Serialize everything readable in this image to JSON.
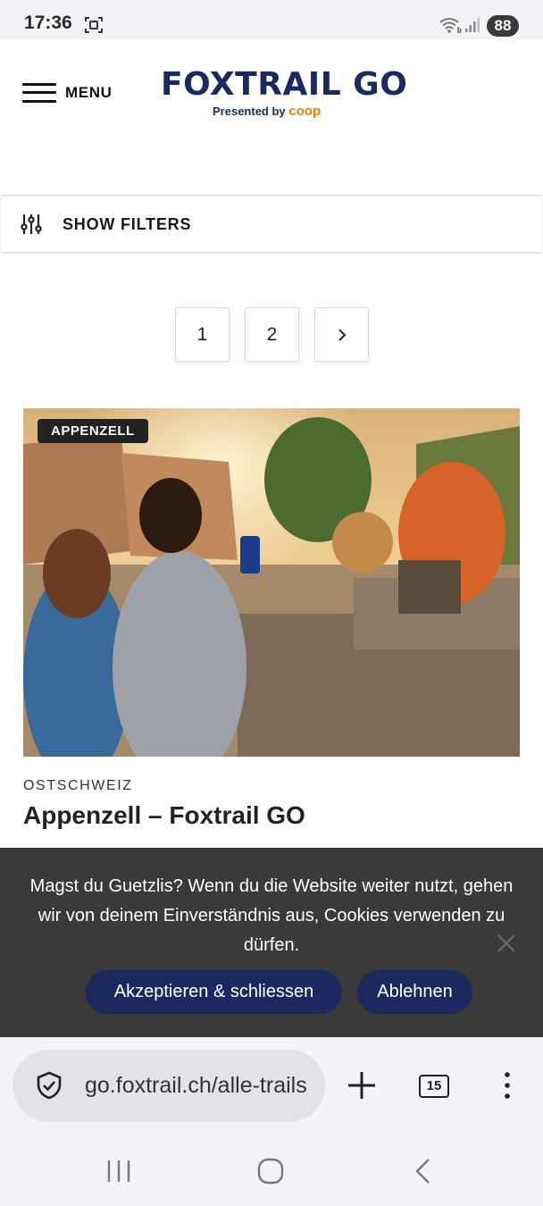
{
  "status_bar": {
    "time": "17:36",
    "battery": "88",
    "icons": [
      "screen-record-icon",
      "wifi-icon",
      "signal-icon"
    ]
  },
  "header": {
    "menu_label": "MENU",
    "logo_title": "FOXTRAIL GO",
    "logo_presented": "Presented by",
    "logo_sponsor": "coop",
    "brand_color": "#1b2a5e",
    "sponsor_color": "#f07d00"
  },
  "filters": {
    "label": "SHOW FILTERS",
    "icon": "sliders-icon"
  },
  "pagination": {
    "pages": [
      "1",
      "2"
    ],
    "next_icon": "chevron-right-icon"
  },
  "trail_card": {
    "badge": "APPENZELL",
    "region": "OSTSCHWEIZ",
    "title": "Appenzell – Foxtrail GO"
  },
  "cookie_banner": {
    "text": "Magst du Guetzlis? Wenn du die Website weiter nutzt, gehen wir von deinem Einverständnis aus, Cookies verwenden zu dürfen.",
    "accept_label": "Akzeptieren & schliessen",
    "reject_label": "Ablehnen",
    "background": "#3a3a3a"
  },
  "browser": {
    "url": "go.foxtrail.ch/alle-trails",
    "tab_count": "15"
  }
}
